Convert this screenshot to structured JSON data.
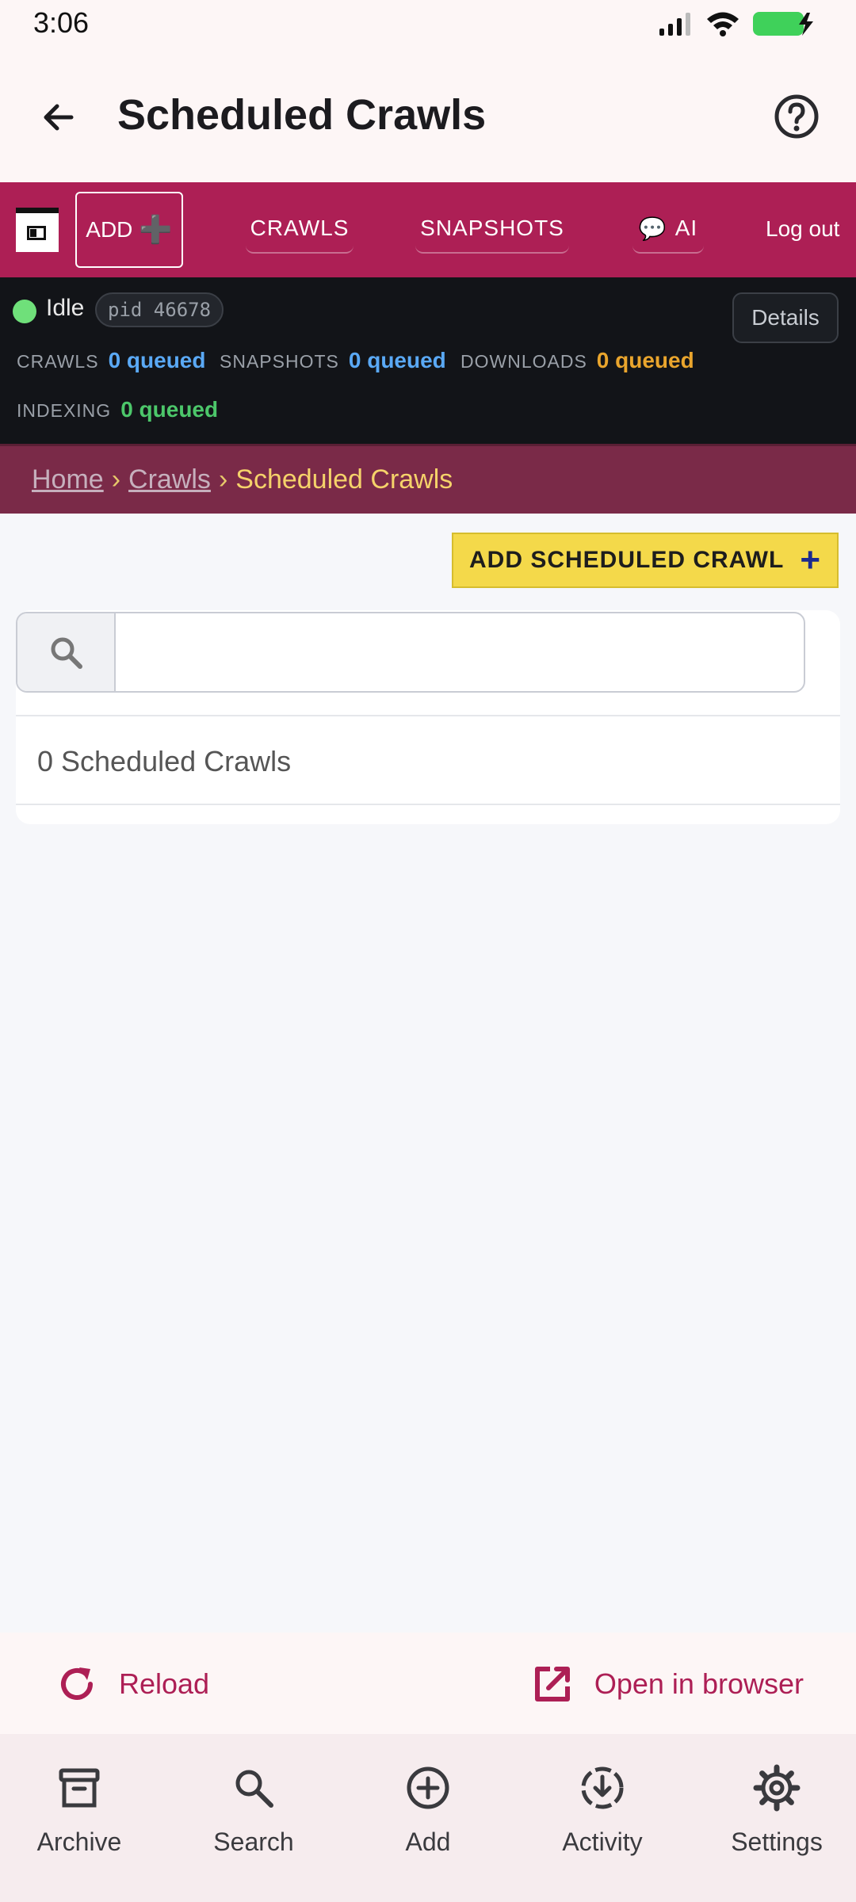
{
  "status_bar": {
    "time": "3:06"
  },
  "appbar": {
    "title": "Scheduled Crawls"
  },
  "navbar": {
    "add_label": "ADD",
    "add_plus": "➕",
    "crawls": "CRAWLS",
    "snapshots": "SNAPSHOTS",
    "ai_emoji": "💬",
    "ai": "AI",
    "logout": "Log out"
  },
  "status_panel": {
    "state": "Idle",
    "pid": "pid 46678",
    "details": "Details",
    "queues": [
      {
        "label": "CRAWLS",
        "value": "0 queued",
        "color": "#5aa9f5"
      },
      {
        "label": "SNAPSHOTS",
        "value": "0 queued",
        "color": "#5aa9f5"
      },
      {
        "label": "DOWNLOADS",
        "value": "0 queued",
        "color": "#e9a52d"
      },
      {
        "label": "INDEXING",
        "value": "0 queued",
        "color": "#4cc76a"
      }
    ]
  },
  "breadcrumb": {
    "home": "Home",
    "sep": "›",
    "crawls": "Crawls",
    "current": "Scheduled Crawls"
  },
  "content": {
    "add_button": "ADD SCHEDULED CRAWL",
    "add_button_plus": "+",
    "search_value": "",
    "count_text": "0 Scheduled Crawls"
  },
  "actions": {
    "reload": "Reload",
    "open": "Open in browser"
  },
  "bottom_nav": {
    "items": [
      {
        "label": "Archive",
        "icon": "archive-icon"
      },
      {
        "label": "Search",
        "icon": "search-icon"
      },
      {
        "label": "Add",
        "icon": "add-circle-icon"
      },
      {
        "label": "Activity",
        "icon": "download-progress-icon"
      },
      {
        "label": "Settings",
        "icon": "gear-icon"
      }
    ]
  },
  "colors": {
    "brand": "#ad1f55",
    "accent_yellow": "#f4d94a"
  }
}
